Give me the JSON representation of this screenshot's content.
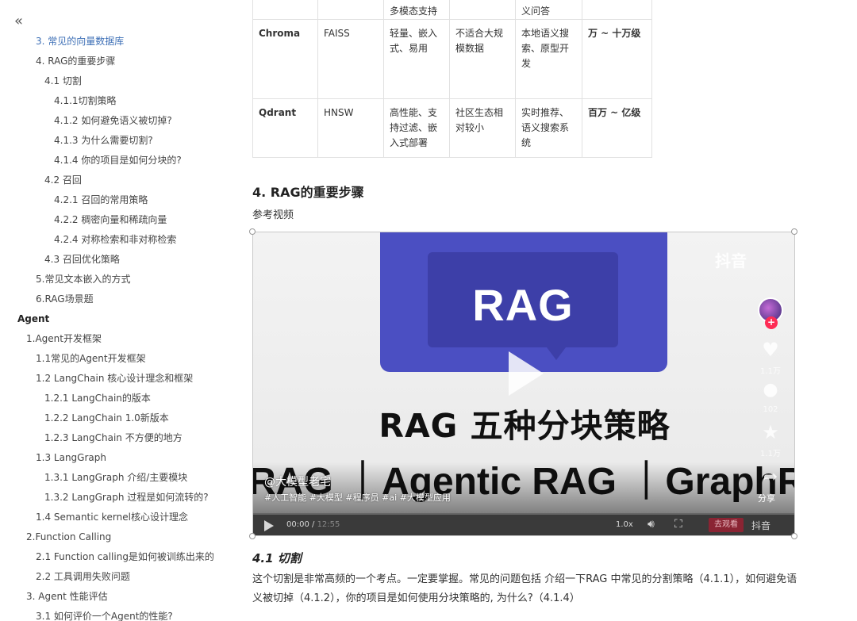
{
  "sidebar": {
    "collapse_glyph": "«",
    "items": [
      {
        "label": "3. 常见的向量数据库",
        "level": 3,
        "active": true
      },
      {
        "label": "4. RAG的重要步骤",
        "level": 3
      },
      {
        "label": "4.1 切割",
        "level": 4
      },
      {
        "label": "4.1.1切割策略",
        "level": 5
      },
      {
        "label": "4.1.2 如何避免语义被切掉?",
        "level": 5
      },
      {
        "label": "4.1.3 为什么需要切割?",
        "level": 5
      },
      {
        "label": "4.1.4 你的项目是如何分块的?",
        "level": 5
      },
      {
        "label": "4.2 召回",
        "level": 4
      },
      {
        "label": "4.2.1 召回的常用策略",
        "level": 5
      },
      {
        "label": "4.2.2 稠密向量和稀疏向量",
        "level": 5
      },
      {
        "label": "4.2.4 对称检索和非对称检索",
        "level": 5
      },
      {
        "label": "4.3 召回优化策略",
        "level": 4
      },
      {
        "label": "5.常见文本嵌入的方式",
        "level": 3
      },
      {
        "label": "6.RAG场景题",
        "level": 3
      },
      {
        "label": "Agent",
        "level": 1,
        "bold": true
      },
      {
        "label": "1.Agent开发框架",
        "level": 2
      },
      {
        "label": "1.1常见的Agent开发框架",
        "level": 3
      },
      {
        "label": "1.2 LangChain 核心设计理念和框架",
        "level": 3
      },
      {
        "label": "1.2.1 LangChain的版本",
        "level": 4
      },
      {
        "label": "1.2.2 LangChain 1.0新版本",
        "level": 4
      },
      {
        "label": "1.2.3 LangChain 不方便的地方",
        "level": 4
      },
      {
        "label": "1.3 LangGraph",
        "level": 3
      },
      {
        "label": "1.3.1 LangGraph 介绍/主要模块",
        "level": 4
      },
      {
        "label": "1.3.2 LangGraph 过程是如何流转的?",
        "level": 4
      },
      {
        "label": "1.4 Semantic kernel核心设计理念",
        "level": 3
      },
      {
        "label": "2.Function Calling",
        "level": 2
      },
      {
        "label": "2.1 Function calling是如何被训练出来的",
        "level": 3
      },
      {
        "label": "2.2 工具调用失败问题",
        "level": 3
      },
      {
        "label": "3. Agent 性能评估",
        "level": 2
      },
      {
        "label": "3.1 如何评价一个Agent的性能?",
        "level": 3
      }
    ]
  },
  "table": {
    "rows": [
      [
        "",
        "",
        "多模态支持",
        "",
        "义问答",
        ""
      ],
      [
        "Chroma",
        "FAISS",
        "轻量、嵌入式、易用",
        "不适合大规模数据",
        "本地语义搜索、原型开发",
        "万 ~ 十万级"
      ],
      [
        "Qdrant",
        "HNSW",
        "高性能、支持过滤、嵌入式部署",
        "社区生态相对较小",
        "实时推荐、语义搜索系统",
        "百万 ~ 亿级"
      ]
    ]
  },
  "section": {
    "title": "4. RAG的重要步骤",
    "ref_label": "参考视频"
  },
  "video": {
    "thumbnail_word": "RAG",
    "headline": "RAG 五种分块策略",
    "headline2": "RAG ｜Agentic RAG ｜GraphRAG",
    "brand": "抖音",
    "author": "@大模型老宅",
    "hashtags": "#人工智能 #大模型 #程序员 #ai #大模型应用",
    "like_count": "1.1万",
    "comment_count": "102",
    "fav_count": "1.1万",
    "share_label": "分享",
    "follow_glyph": "+",
    "current_time": "00:00",
    "time_sep": " / ",
    "total_time": "12:55",
    "speed": "1.0x",
    "watch_btn": "去观看",
    "douyin_label": "抖音",
    "progress": 0.0,
    "icons": {
      "play": "play-icon",
      "like": "heart-icon",
      "comment": "comment-icon",
      "fav": "star-icon",
      "share": "share-icon",
      "volume": "volume-icon",
      "fullscreen": "fullscreen-icon"
    },
    "colors": {
      "accent": "#4b4fc2",
      "follow": "#fe2c55"
    }
  },
  "subsection": {
    "title": "4.1 切割",
    "paragraph": "这个切割是非常高频的一个考点。一定要掌握。常见的问题包括 介绍一下RAG 中常见的分割策略（4.1.1），如何避免语义被切掉（4.1.2），你的项目是如何使用分块策略的, 为什么?（4.1.4）"
  }
}
